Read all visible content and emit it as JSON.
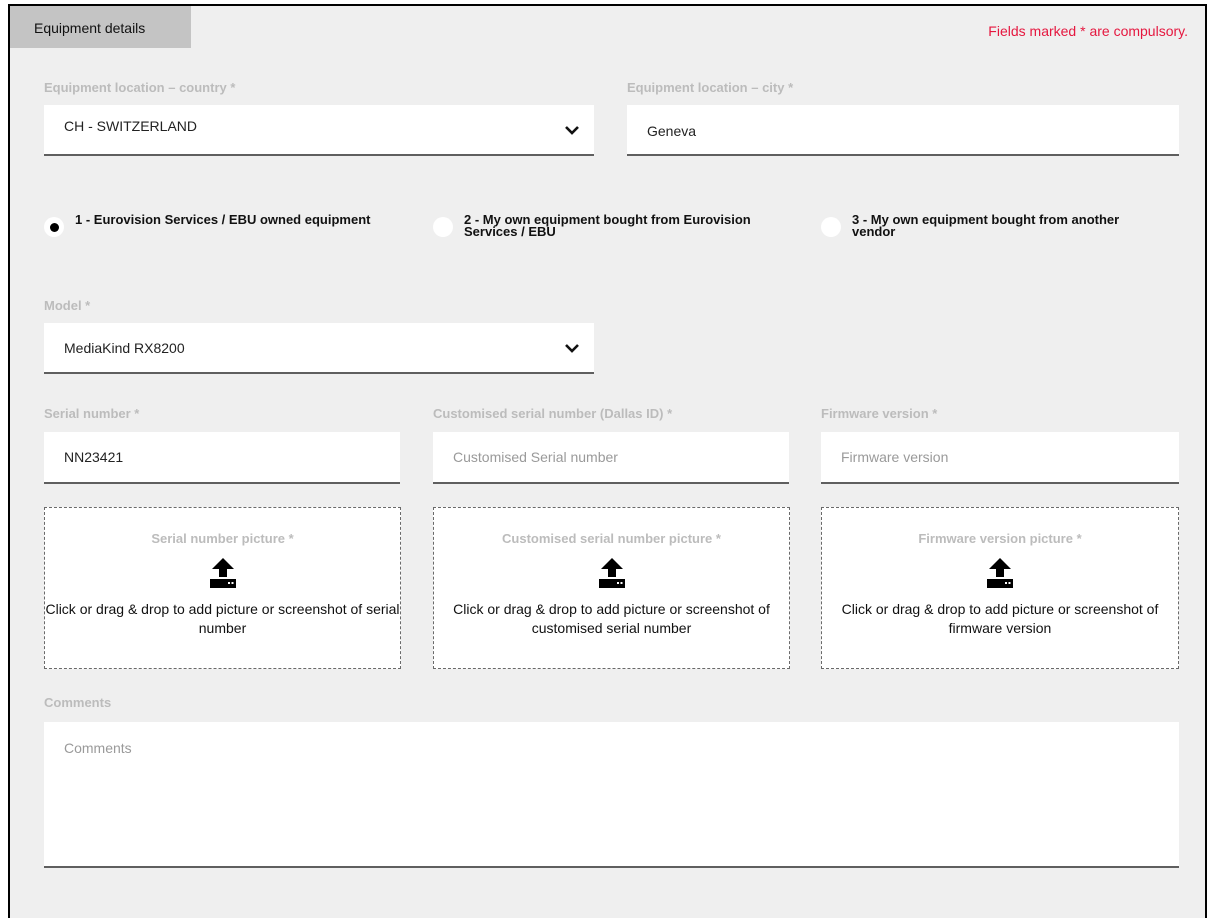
{
  "header": {
    "tab_label": "Equipment details",
    "compulsory_note": "Fields marked * are compulsory."
  },
  "location": {
    "country": {
      "label": "Equipment location – country *",
      "value": "CH - SWITZERLAND"
    },
    "city": {
      "label": "Equipment location – city *",
      "value": "Geneva"
    }
  },
  "ownership": {
    "options": [
      {
        "label": "1 - Eurovision Services / EBU owned equipment",
        "selected": true
      },
      {
        "label": "2 - My own equipment bought from Eurovision Services / EBU",
        "selected": false
      },
      {
        "label": "3 - My own equipment bought from another vendor",
        "selected": false
      }
    ]
  },
  "model": {
    "label": "Model *",
    "value": "MediaKind RX8200"
  },
  "serial": {
    "label": "Serial number *",
    "value": "NN23421"
  },
  "custom_serial": {
    "label": "Customised serial number (Dallas ID) *",
    "placeholder": "Customised Serial number"
  },
  "firmware": {
    "label": "Firmware version *",
    "placeholder": "Firmware version"
  },
  "uploads": [
    {
      "title": "Serial number picture *",
      "text": "Click or drag & drop to add picture or screenshot of serial number",
      "icon": "upload-icon"
    },
    {
      "title": "Customised serial number picture *",
      "text": "Click or drag & drop to add picture or screenshot of customised serial number",
      "icon": "upload-icon"
    },
    {
      "title": "Firmware version picture *",
      "text": "Click or drag & drop to add picture or screenshot of firmware version",
      "icon": "upload-icon"
    }
  ],
  "comments": {
    "label": "Comments",
    "placeholder": "Comments"
  },
  "colors": {
    "accent_red": "#e5173f",
    "panel_bg": "#efefef",
    "tab_bg": "#c4c4c4"
  }
}
